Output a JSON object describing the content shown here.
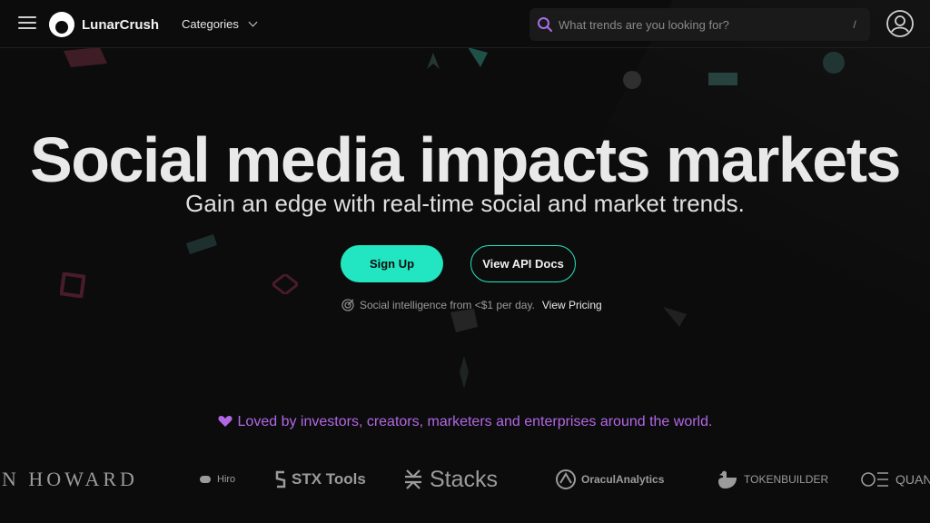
{
  "header": {
    "brand": "LunarCrush",
    "categories_label": "Categories",
    "search": {
      "placeholder": "What trends are you looking for?",
      "shortcut": "/"
    }
  },
  "hero": {
    "headline": "Social media impacts markets",
    "subheadline": "Gain an edge with real-time social and market trends.",
    "signup_label": "Sign Up",
    "api_label": "View API Docs",
    "pricing_text": "Social intelligence from <$1 per day.",
    "pricing_link": "View Pricing"
  },
  "loved": {
    "text": "Loved by investors, creators, marketers and enterprises around the world."
  },
  "logos": [
    {
      "name": "N HOWARD"
    },
    {
      "name": "Hiro"
    },
    {
      "name": "STX Tools"
    },
    {
      "name": "Stacks"
    },
    {
      "name": "OraculAnalytics"
    },
    {
      "name": "TOKENBUILDER"
    },
    {
      "name": "QUAN"
    }
  ],
  "colors": {
    "accent": "#21e6c1",
    "purple": "#b267e6",
    "background": "#0c0c0c"
  }
}
